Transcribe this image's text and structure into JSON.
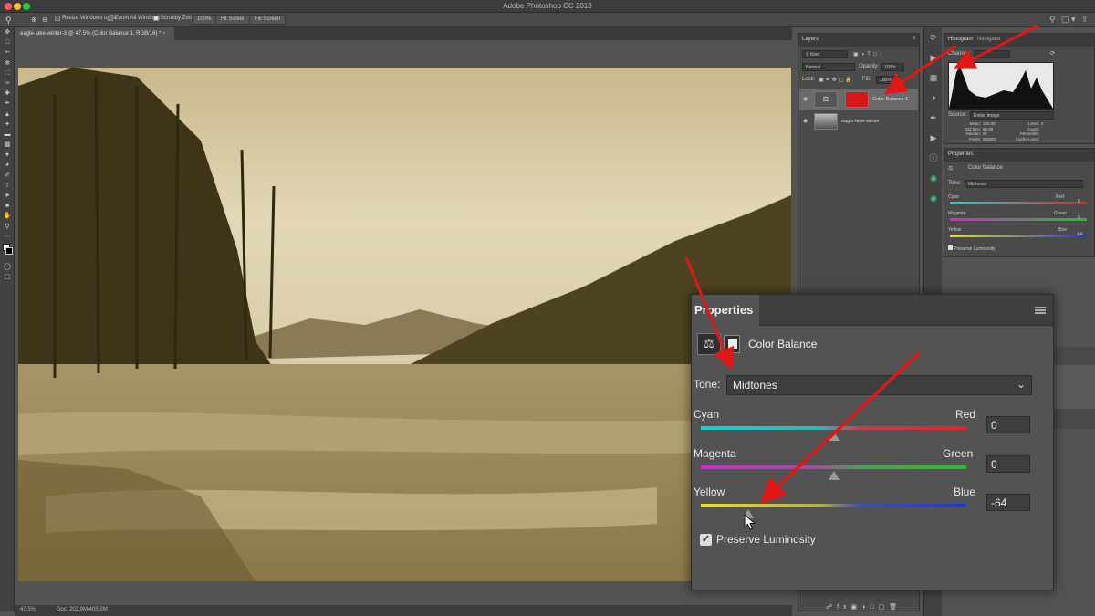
{
  "app": {
    "title": "Adobe Photoshop CC 2018"
  },
  "colors": {
    "accent_red": "#e01818",
    "sepia": "#cfc19a"
  },
  "options_bar": {
    "resize_windows": "Resize Windows to Fit",
    "zoom_all": "Zoom All Windows",
    "scrubby_zoom": "Scrubby Zoom",
    "zoom_pct": "100%",
    "fit_screen": "Fit Screen",
    "fill_screen": "Fill Screen"
  },
  "document": {
    "tab_label": "eagle-lake-winter-3 @ 47.5% (Color Balance 1, RGB/16) *"
  },
  "status": {
    "zoom": "47.5%",
    "doc": "Doc: 202.9M/405.2M"
  },
  "layers_panel": {
    "tab": "Layers",
    "kind": "Kind",
    "blend_mode": "Normal",
    "opacity_label": "Opacity:",
    "opacity_value": "100%",
    "lock_label": "Lock:",
    "fill_label": "Fill:",
    "fill_value": "100%",
    "layers": [
      {
        "name": "Color Balance 1"
      },
      {
        "name": "eagle-lake-winter"
      }
    ]
  },
  "histogram_panel": {
    "tabs": [
      "Histogram",
      "Navigator"
    ],
    "channel_label": "Channel:",
    "source_label": "Source:",
    "source_value": "Entire Image",
    "stats_left": [
      "Mean:",
      "Std Dev:",
      "Median:",
      "Pixels:"
    ],
    "stats_left_values": [
      "100.09",
      "66.88",
      "97",
      "553853"
    ],
    "stats_right": [
      "Level:",
      "Count:",
      "Percentile:",
      "Cache Level:"
    ],
    "stats_right_values": [
      "",
      "",
      "",
      "4"
    ]
  },
  "small_properties": {
    "tab": "Properties",
    "adjustment": "Color Balance",
    "tone_label": "Tone:",
    "tone_value": "Midtones",
    "rows": [
      {
        "left": "Cyan",
        "right": "Red",
        "value": "0"
      },
      {
        "left": "Magenta",
        "right": "Green",
        "value": "0"
      },
      {
        "left": "Yellow",
        "right": "Blue",
        "value": "-64"
      }
    ],
    "preserve": "Preserve Luminosity"
  },
  "properties": {
    "tab": "Properties",
    "adjustment": "Color Balance",
    "tone_label": "Tone:",
    "tone_value": "Midtones",
    "sliders": [
      {
        "left": "Cyan",
        "right": "Red",
        "value": "0",
        "position": 0.5
      },
      {
        "left": "Magenta",
        "right": "Green",
        "value": "0",
        "position": 0.5
      },
      {
        "left": "Yellow",
        "right": "Blue",
        "value": "-64",
        "position": 0.18
      }
    ],
    "preserve_luminosity": "Preserve Luminosity",
    "preserve_checked": true
  }
}
